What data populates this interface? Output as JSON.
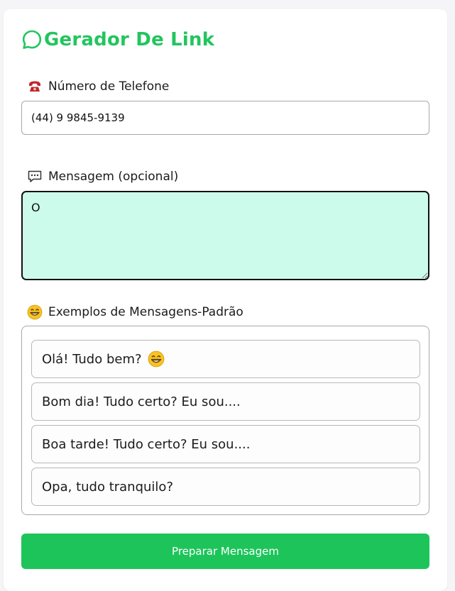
{
  "header": {
    "title": "Gerador De Link",
    "icon": "whatsapp-icon",
    "accent_color": "#22c55e"
  },
  "phone": {
    "label": "Número de Telefone",
    "icon": "telephone-icon",
    "value": "(44) 9 9845-9139"
  },
  "message": {
    "label": "Mensagem (opcional)",
    "icon": "speech-bubble-icon",
    "value": "O",
    "background_color": "#ccfbec"
  },
  "examples": {
    "label": "Exemplos de Mensagens-Padrão",
    "icon": "grinning-face-icon",
    "items": [
      {
        "text": "Olá! Tudo bem?",
        "emoji": "grinning-face-icon"
      },
      {
        "text": "Bom dia! Tudo certo? Eu sou...."
      },
      {
        "text": "Boa tarde! Tudo certo? Eu sou...."
      },
      {
        "text": "Opa, tudo tranquilo?"
      }
    ]
  },
  "submit": {
    "label": "Preparar Mensagem",
    "color": "#1dc45a"
  }
}
